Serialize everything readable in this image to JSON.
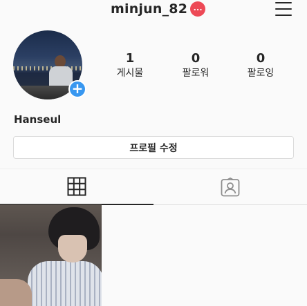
{
  "header": {
    "username": "minjun_82",
    "notification_badge": "...",
    "menu_icon": "hamburger-menu-icon"
  },
  "profile": {
    "display_name": "Hanseul",
    "add_icon": "+",
    "stats": [
      {
        "value": "1",
        "label": "게시물"
      },
      {
        "value": "0",
        "label": "팔로워"
      },
      {
        "value": "0",
        "label": "팔로잉"
      }
    ],
    "edit_button_label": "프로필 수정"
  },
  "tabs": [
    {
      "icon": "grid-icon",
      "active": true
    },
    {
      "icon": "tagged-icon",
      "active": false
    }
  ],
  "colors": {
    "accent_blue": "#3897f0",
    "badge_red": "#ed4956",
    "text": "#262626",
    "background": "#fafafa"
  }
}
